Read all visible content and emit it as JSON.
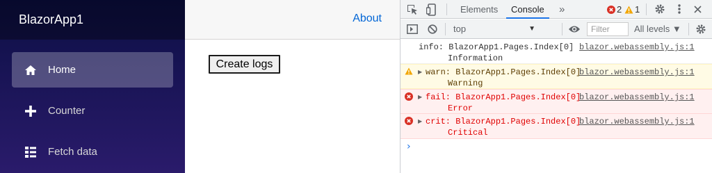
{
  "app": {
    "brand": "BlazorApp1",
    "about_label": "About",
    "nav": [
      {
        "label": "Home",
        "icon": "home-icon",
        "active": true
      },
      {
        "label": "Counter",
        "icon": "plus-icon",
        "active": false
      },
      {
        "label": "Fetch data",
        "icon": "list-rich-icon",
        "active": false
      }
    ],
    "create_logs_label": "Create logs"
  },
  "devtools": {
    "tabs": {
      "elements": "Elements",
      "console": "Console",
      "more": "»"
    },
    "error_count": "2",
    "warning_count": "1",
    "context": "top",
    "filter_placeholder": "Filter",
    "levels": "All levels ▼",
    "messages": [
      {
        "level": "info",
        "prefix": "info:",
        "category": "BlazorApp1.Pages.Index[0]",
        "text": "Information",
        "source": "blazor.webassembly.js:1"
      },
      {
        "level": "warn",
        "prefix": "warn:",
        "category": "BlazorApp1.Pages.Index[0]",
        "text": "Warning",
        "source": "blazor.webassembly.js:1"
      },
      {
        "level": "fail",
        "prefix": "fail:",
        "category": "BlazorApp1.Pages.Index[0]",
        "text": "Error",
        "source": "blazor.webassembly.js:1"
      },
      {
        "level": "crit",
        "prefix": "crit:",
        "category": "BlazorApp1.Pages.Index[0]",
        "text": "Critical",
        "source": "blazor.webassembly.js:1"
      }
    ],
    "prompt": "›"
  },
  "colors": {
    "sidebar_top": "#0c0f45",
    "sidebar_bottom": "#2a1b6b",
    "link": "#0366d6",
    "accent": "#1a73e8",
    "error": "#e00000",
    "warning_bg": "#fffbe5"
  }
}
